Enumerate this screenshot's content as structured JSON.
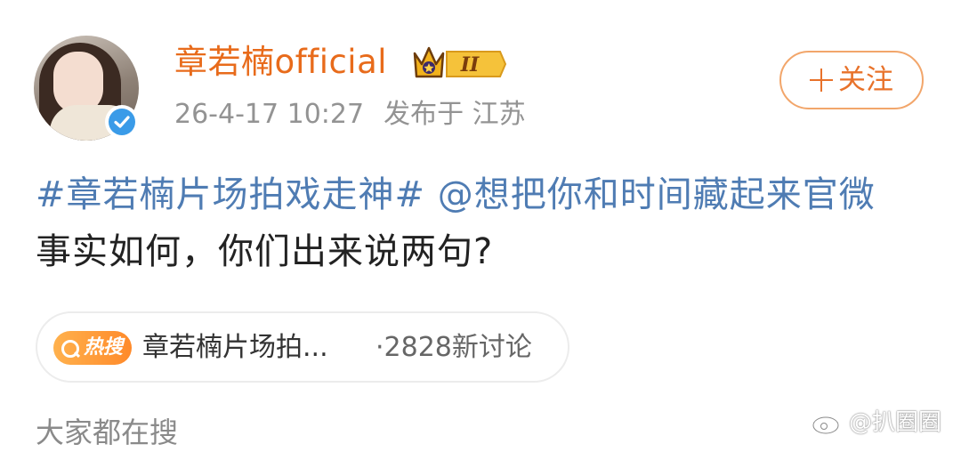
{
  "user": {
    "name": "章若楠official",
    "badge_level": "II"
  },
  "meta": {
    "time": "26-4-17 10:27",
    "location": "发布于 江苏"
  },
  "follow_button": {
    "label": "关注"
  },
  "post": {
    "hashtag": "#章若楠片场拍戏走神#",
    "mention": "@想把你和时间藏起来官微",
    "body": "事实如何，你们出来说两句?"
  },
  "hot_search": {
    "tag": "热搜",
    "title": "章若楠片场拍...",
    "discussion_count": "·2828新讨论"
  },
  "section": {
    "label": "大家都在搜"
  },
  "watermark": {
    "text": "@扒圈圈"
  },
  "colors": {
    "username": "#e86b1b",
    "link": "#4f7cb3",
    "follow_border": "#f2a66b",
    "verified": "#3a9be8"
  }
}
